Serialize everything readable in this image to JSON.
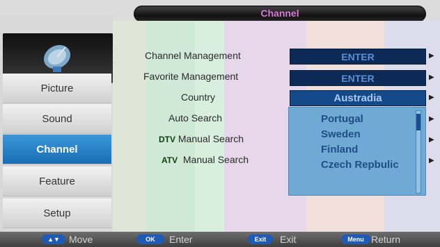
{
  "header": {
    "title": "Channel"
  },
  "sidebar": {
    "items": [
      {
        "label": "Picture"
      },
      {
        "label": "Sound"
      },
      {
        "label": "Channel"
      },
      {
        "label": "Feature"
      },
      {
        "label": "Setup"
      }
    ]
  },
  "menu": {
    "channel_management": {
      "label": "Channel Management",
      "value": "ENTER"
    },
    "favorite_management": {
      "label": "Favorite Management",
      "value": "ENTER"
    },
    "country": {
      "label": "Country",
      "value": "Austradia"
    },
    "auto_search": {
      "label": "Auto Search"
    },
    "dtv_manual_search": {
      "prefix": "DTV",
      "label": "Manual Search"
    },
    "atv_manual_search": {
      "prefix": "ATV",
      "label": "Manual Search"
    }
  },
  "country_dropdown": {
    "options": [
      "Portugal",
      "Sweden",
      "Finland",
      "Czech Repbulic"
    ]
  },
  "footer": {
    "move": {
      "key": "▲▼",
      "label": "Move"
    },
    "enter": {
      "key": "OK",
      "label": "Enter"
    },
    "exit": {
      "key": "Exit",
      "label": "Exit"
    },
    "return": {
      "key": "Menu",
      "label": "Return"
    }
  },
  "colors": {
    "active_tab": "#2a82c8",
    "value_box": "#0c2a55",
    "title_text": "#d57ad9",
    "dropdown_bg": "#6faad4"
  }
}
